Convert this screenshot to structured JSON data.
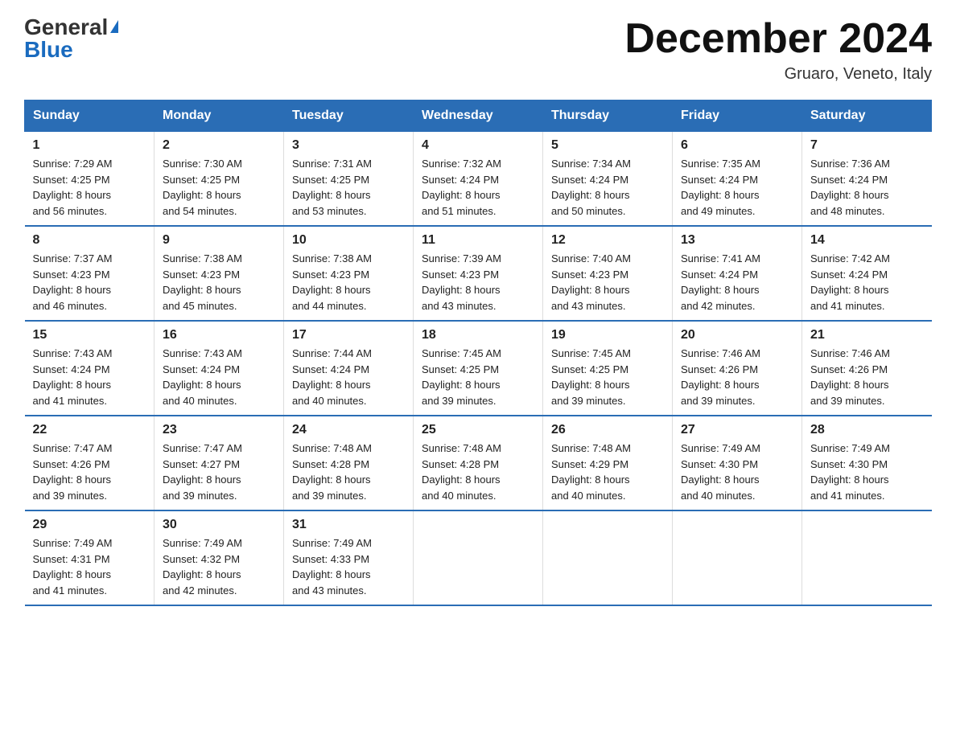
{
  "logo": {
    "general": "General",
    "blue": "Blue",
    "triangle": "▲"
  },
  "title": "December 2024",
  "location": "Gruaro, Veneto, Italy",
  "headers": [
    "Sunday",
    "Monday",
    "Tuesday",
    "Wednesday",
    "Thursday",
    "Friday",
    "Saturday"
  ],
  "weeks": [
    [
      {
        "day": "1",
        "sunrise": "7:29 AM",
        "sunset": "4:25 PM",
        "daylight": "8 hours and 56 minutes."
      },
      {
        "day": "2",
        "sunrise": "7:30 AM",
        "sunset": "4:25 PM",
        "daylight": "8 hours and 54 minutes."
      },
      {
        "day": "3",
        "sunrise": "7:31 AM",
        "sunset": "4:25 PM",
        "daylight": "8 hours and 53 minutes."
      },
      {
        "day": "4",
        "sunrise": "7:32 AM",
        "sunset": "4:24 PM",
        "daylight": "8 hours and 51 minutes."
      },
      {
        "day": "5",
        "sunrise": "7:34 AM",
        "sunset": "4:24 PM",
        "daylight": "8 hours and 50 minutes."
      },
      {
        "day": "6",
        "sunrise": "7:35 AM",
        "sunset": "4:24 PM",
        "daylight": "8 hours and 49 minutes."
      },
      {
        "day": "7",
        "sunrise": "7:36 AM",
        "sunset": "4:24 PM",
        "daylight": "8 hours and 48 minutes."
      }
    ],
    [
      {
        "day": "8",
        "sunrise": "7:37 AM",
        "sunset": "4:23 PM",
        "daylight": "8 hours and 46 minutes."
      },
      {
        "day": "9",
        "sunrise": "7:38 AM",
        "sunset": "4:23 PM",
        "daylight": "8 hours and 45 minutes."
      },
      {
        "day": "10",
        "sunrise": "7:38 AM",
        "sunset": "4:23 PM",
        "daylight": "8 hours and 44 minutes."
      },
      {
        "day": "11",
        "sunrise": "7:39 AM",
        "sunset": "4:23 PM",
        "daylight": "8 hours and 43 minutes."
      },
      {
        "day": "12",
        "sunrise": "7:40 AM",
        "sunset": "4:23 PM",
        "daylight": "8 hours and 43 minutes."
      },
      {
        "day": "13",
        "sunrise": "7:41 AM",
        "sunset": "4:24 PM",
        "daylight": "8 hours and 42 minutes."
      },
      {
        "day": "14",
        "sunrise": "7:42 AM",
        "sunset": "4:24 PM",
        "daylight": "8 hours and 41 minutes."
      }
    ],
    [
      {
        "day": "15",
        "sunrise": "7:43 AM",
        "sunset": "4:24 PM",
        "daylight": "8 hours and 41 minutes."
      },
      {
        "day": "16",
        "sunrise": "7:43 AM",
        "sunset": "4:24 PM",
        "daylight": "8 hours and 40 minutes."
      },
      {
        "day": "17",
        "sunrise": "7:44 AM",
        "sunset": "4:24 PM",
        "daylight": "8 hours and 40 minutes."
      },
      {
        "day": "18",
        "sunrise": "7:45 AM",
        "sunset": "4:25 PM",
        "daylight": "8 hours and 39 minutes."
      },
      {
        "day": "19",
        "sunrise": "7:45 AM",
        "sunset": "4:25 PM",
        "daylight": "8 hours and 39 minutes."
      },
      {
        "day": "20",
        "sunrise": "7:46 AM",
        "sunset": "4:26 PM",
        "daylight": "8 hours and 39 minutes."
      },
      {
        "day": "21",
        "sunrise": "7:46 AM",
        "sunset": "4:26 PM",
        "daylight": "8 hours and 39 minutes."
      }
    ],
    [
      {
        "day": "22",
        "sunrise": "7:47 AM",
        "sunset": "4:26 PM",
        "daylight": "8 hours and 39 minutes."
      },
      {
        "day": "23",
        "sunrise": "7:47 AM",
        "sunset": "4:27 PM",
        "daylight": "8 hours and 39 minutes."
      },
      {
        "day": "24",
        "sunrise": "7:48 AM",
        "sunset": "4:28 PM",
        "daylight": "8 hours and 39 minutes."
      },
      {
        "day": "25",
        "sunrise": "7:48 AM",
        "sunset": "4:28 PM",
        "daylight": "8 hours and 40 minutes."
      },
      {
        "day": "26",
        "sunrise": "7:48 AM",
        "sunset": "4:29 PM",
        "daylight": "8 hours and 40 minutes."
      },
      {
        "day": "27",
        "sunrise": "7:49 AM",
        "sunset": "4:30 PM",
        "daylight": "8 hours and 40 minutes."
      },
      {
        "day": "28",
        "sunrise": "7:49 AM",
        "sunset": "4:30 PM",
        "daylight": "8 hours and 41 minutes."
      }
    ],
    [
      {
        "day": "29",
        "sunrise": "7:49 AM",
        "sunset": "4:31 PM",
        "daylight": "8 hours and 41 minutes."
      },
      {
        "day": "30",
        "sunrise": "7:49 AM",
        "sunset": "4:32 PM",
        "daylight": "8 hours and 42 minutes."
      },
      {
        "day": "31",
        "sunrise": "7:49 AM",
        "sunset": "4:33 PM",
        "daylight": "8 hours and 43 minutes."
      },
      null,
      null,
      null,
      null
    ]
  ],
  "labels": {
    "sunrise": "Sunrise:",
    "sunset": "Sunset:",
    "daylight": "Daylight:"
  }
}
